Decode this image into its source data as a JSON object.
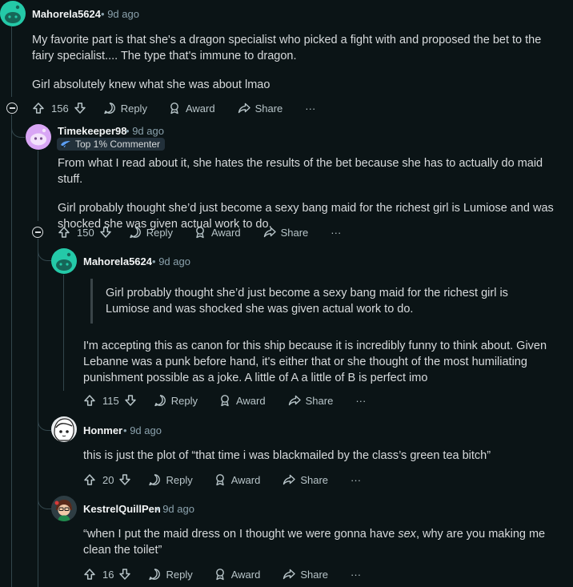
{
  "comments": [
    {
      "username": "Mahorela5624",
      "time": "9d ago",
      "paragraphs": [
        "My favorite part is that she's a dragon specialist who picked a fight with and proposed the bet to the fairy specialist.... The type that's immune to dragon.",
        "Girl absolutely knew what she was about lmao"
      ],
      "votes": "156"
    },
    {
      "username": "Timekeeper98",
      "time": "9d ago",
      "badge": "Top 1% Commenter",
      "paragraphs": [
        "From what I read about it, she hates the results of the bet because she has to actually do maid stuff.",
        "Girl probably thought she’d just become a sexy bang maid for the richest girl is Lumiose and was shocked she was given actual work to do."
      ],
      "votes": "150"
    },
    {
      "username": "Mahorela5624",
      "time": "9d ago",
      "quote": "Girl probably thought she’d just become a sexy bang maid for the richest girl is Lumiose and was shocked she was given actual work to do.",
      "paragraphs": [
        "I'm accepting this as canon for this ship because it is incredibly funny to think about. Given Lebanne was a punk before hand, it's either that or she thought of the most humiliating punishment possible as a joke. A little of A a little of B is perfect imo"
      ],
      "votes": "115"
    },
    {
      "username": "Honmer",
      "time": "9d ago",
      "paragraphs": [
        "this is just the plot of “that time i was blackmailed by the class’s green tea bitch”"
      ],
      "votes": "20"
    },
    {
      "username": "KestrelQuillPen",
      "time": "9d ago",
      "text_before": "“when I put the maid dress on I thought we were gonna have ",
      "text_em": "sex",
      "text_after": ", why are you making me clean the toilet”",
      "votes": "16"
    }
  ],
  "actions": {
    "reply": "Reply",
    "award": "Award",
    "share": "Share",
    "more": "···"
  },
  "separator": "•",
  "colors": {
    "background": "#0b1416",
    "thread_line": "#33464c",
    "avatar_mint": "#24c9a8",
    "avatar_lavender": "#d9a6f5"
  }
}
